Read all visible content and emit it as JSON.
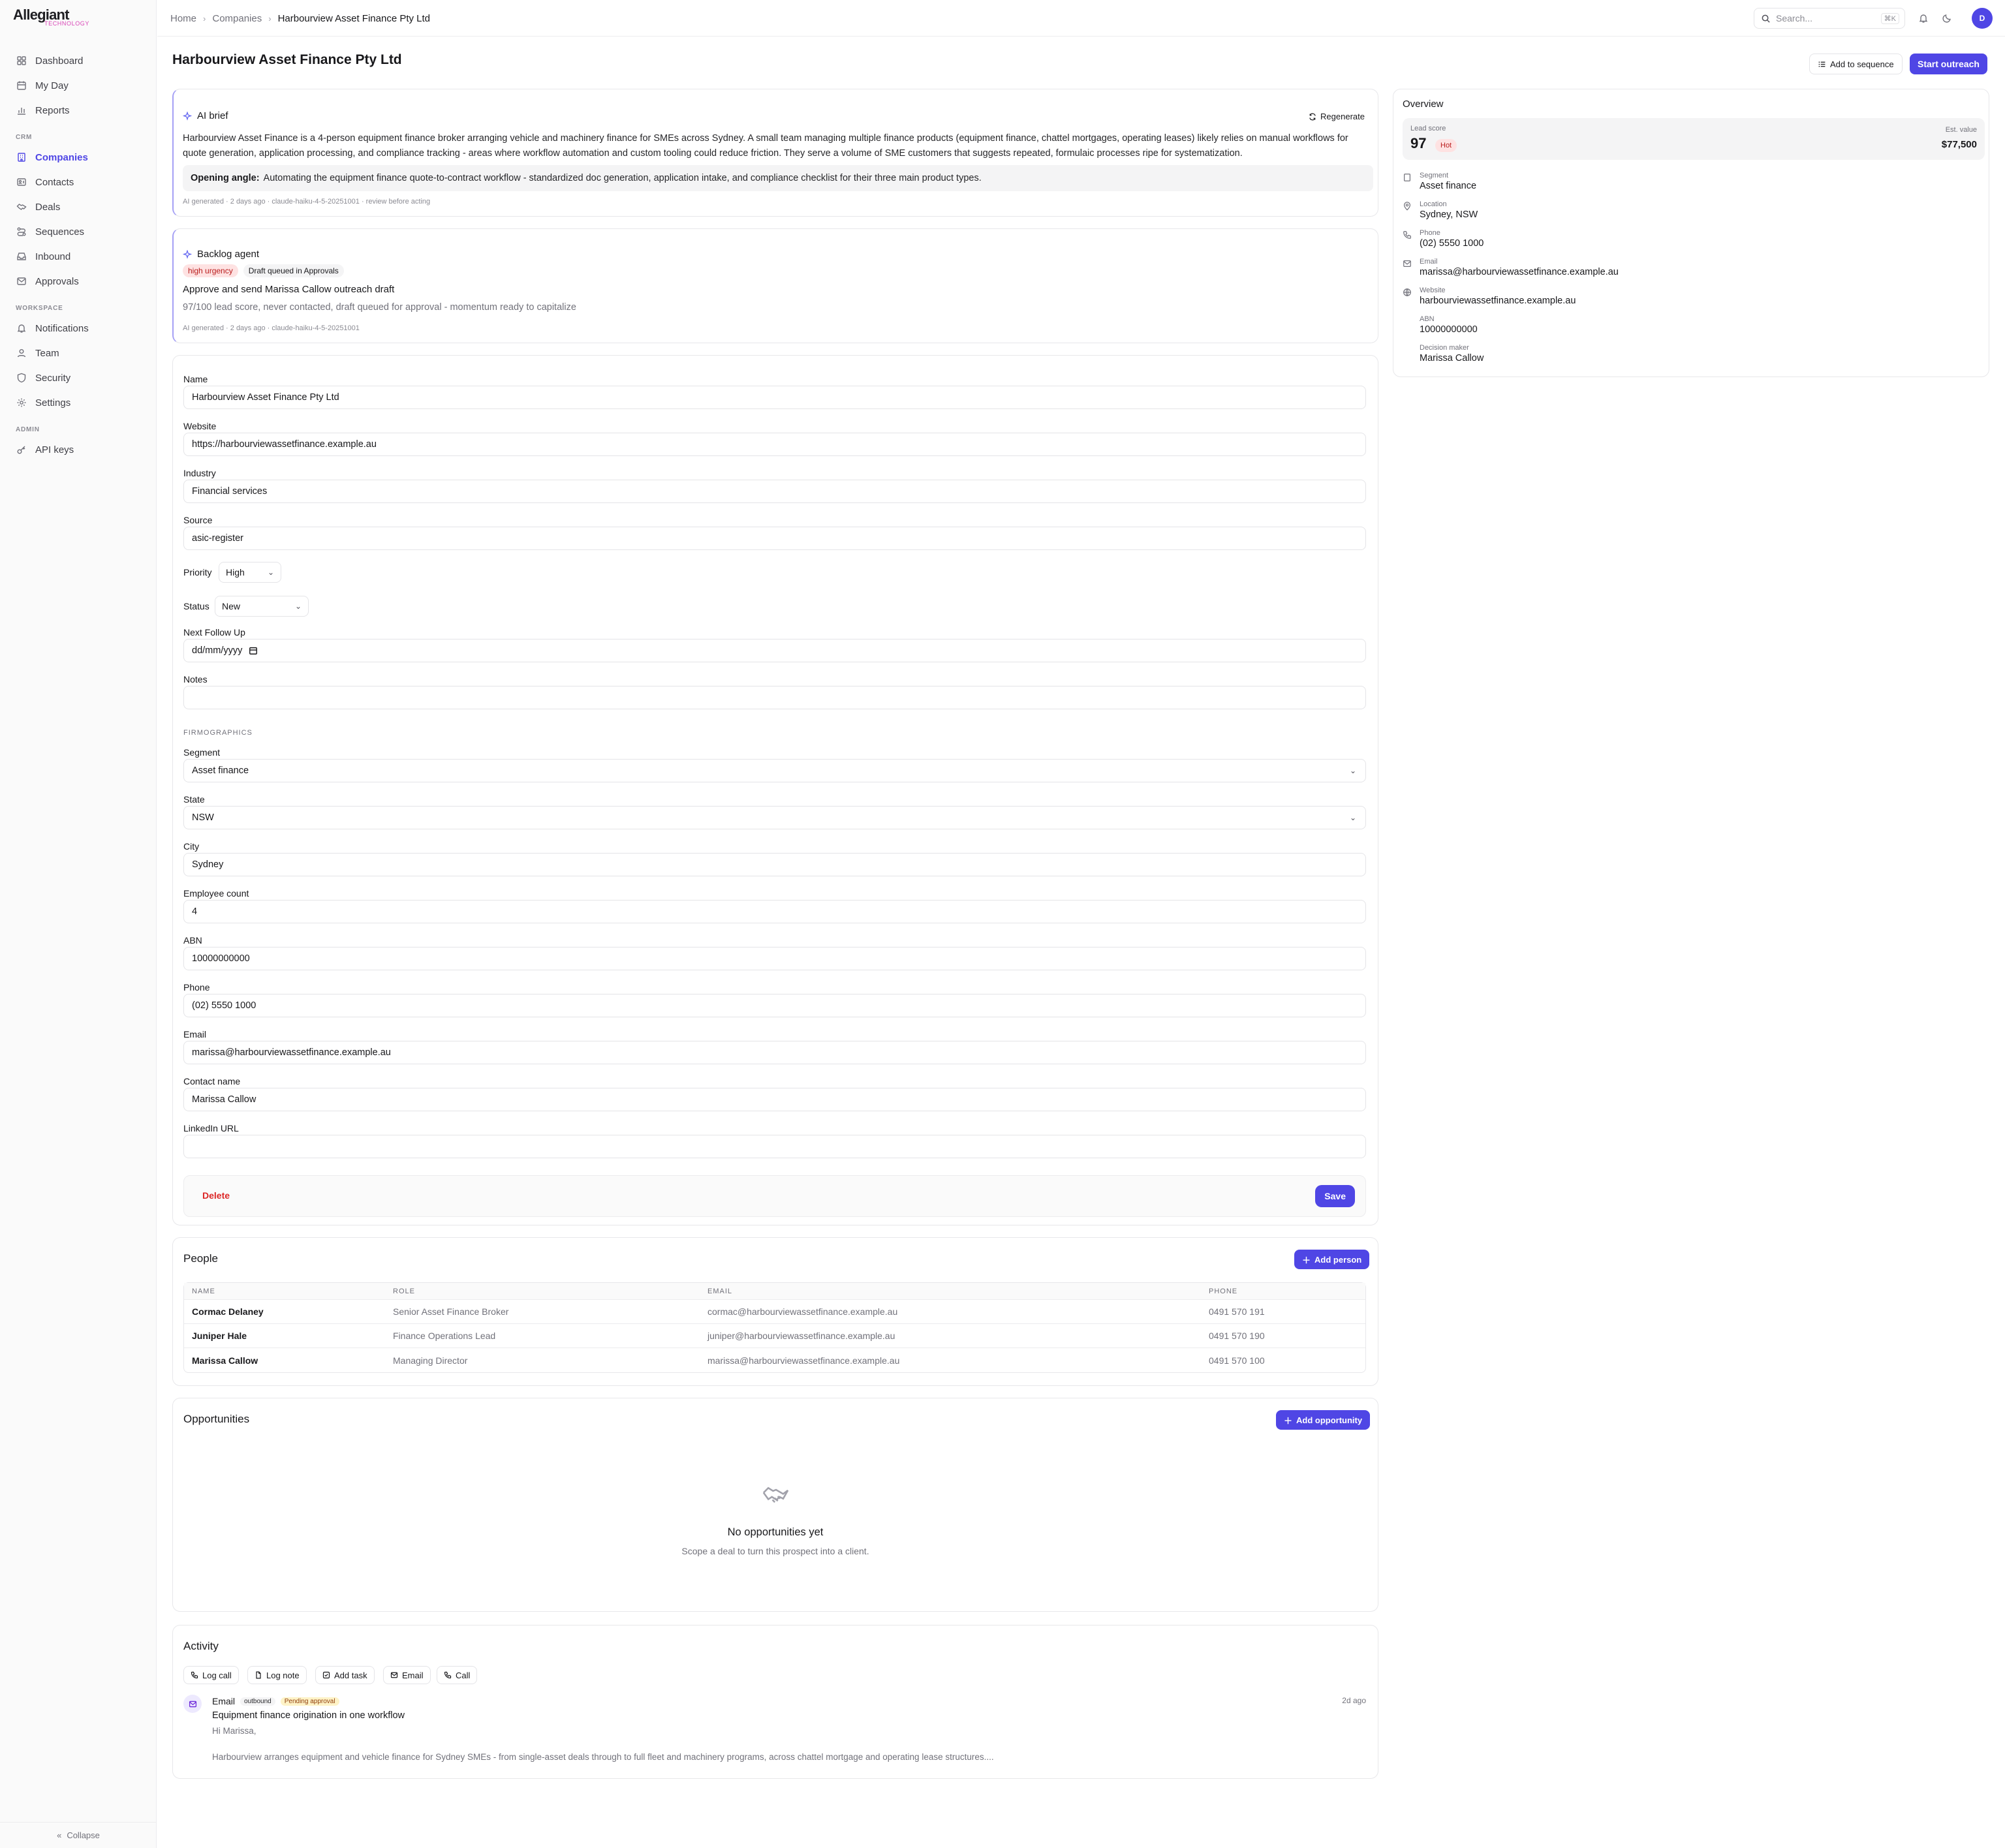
{
  "brand": {
    "name": "Allegiant",
    "sub": "TECHNOLOGY"
  },
  "sidebar": {
    "items": [
      {
        "label": "Dashboard"
      },
      {
        "label": "My Day"
      },
      {
        "label": "Reports"
      }
    ],
    "crm_label": "CRM",
    "crm_items": [
      {
        "label": "Companies"
      },
      {
        "label": "Contacts"
      },
      {
        "label": "Deals"
      },
      {
        "label": "Sequences"
      },
      {
        "label": "Inbound"
      },
      {
        "label": "Approvals"
      }
    ],
    "workspace_label": "WORKSPACE",
    "workspace_items": [
      {
        "label": "Notifications"
      },
      {
        "label": "Team"
      },
      {
        "label": "Security"
      },
      {
        "label": "Settings"
      }
    ],
    "admin_label": "ADMIN",
    "admin_items": [
      {
        "label": "API keys"
      }
    ],
    "collapse_label": "Collapse"
  },
  "header": {
    "breadcrumb": [
      "Home",
      "Companies",
      "Harbourview Asset Finance Pty Ltd"
    ],
    "search_placeholder": "Search...",
    "search_kbd": "⌘K",
    "avatar_initial": "D"
  },
  "page": {
    "title": "Harbourview Asset Finance Pty Ltd",
    "add_to_sequence": "Add to sequence",
    "start_outreach": "Start outreach"
  },
  "ai_brief": {
    "title": "AI brief",
    "regenerate": "Regenerate",
    "body": "Harbourview Asset Finance is a 4-person equipment finance broker arranging vehicle and machinery finance for SMEs across Sydney. A small team managing multiple finance products (equipment finance, chattel mortgages, operating leases) likely relies on manual workflows for quote generation, application processing, and compliance tracking - areas where workflow automation and custom tooling could reduce friction. They serve a volume of SME customers that suggests repeated, formulaic processes ripe for systematization.",
    "angle_label": "Opening angle:",
    "angle_text": "Automating the equipment finance quote-to-contract workflow - standardized doc generation, application intake, and compliance checklist for their three main product types.",
    "meta": "AI generated · 2 days ago · claude-haiku-4-5-20251001 · review before acting"
  },
  "backlog": {
    "title": "Backlog agent",
    "badge_urgency": "high urgency",
    "badge_status": "Draft queued in Approvals",
    "headline": "Approve and send Marissa Callow outreach draft",
    "detail": "97/100 lead score, never contacted, draft queued for approval - momentum ready to capitalize",
    "meta": "AI generated · 2 days ago · claude-haiku-4-5-20251001"
  },
  "form": {
    "name_label": "Name",
    "name_value": "Harbourview Asset Finance Pty Ltd",
    "website_label": "Website",
    "website_value": "https://harbourviewassetfinance.example.au",
    "industry_label": "Industry",
    "industry_value": "Financial services",
    "source_label": "Source",
    "source_value": "asic-register",
    "priority_label": "Priority",
    "priority_value": "High",
    "status_label": "Status",
    "status_value": "New",
    "followup_label": "Next Follow Up",
    "followup_value": "dd/mm/yyyy",
    "notes_label": "Notes",
    "notes_value": "",
    "firmographics_label": "FIRMOGRAPHICS",
    "segment_label": "Segment",
    "segment_value": "Asset finance",
    "state_label": "State",
    "state_value": "NSW",
    "city_label": "City",
    "city_value": "Sydney",
    "employees_label": "Employee count",
    "employees_value": "4",
    "abn_label": "ABN",
    "abn_value": "10000000000",
    "phone_label": "Phone",
    "phone_value": "(02) 5550 1000",
    "email_label": "Email",
    "email_value": "marissa@harbourviewassetfinance.example.au",
    "contact_label": "Contact name",
    "contact_value": "Marissa Callow",
    "linkedin_label": "LinkedIn URL",
    "linkedin_value": "",
    "delete": "Delete",
    "save": "Save"
  },
  "overview": {
    "title": "Overview",
    "lead_score_label": "Lead score",
    "lead_score": "97",
    "lead_badge": "Hot",
    "est_value_label": "Est. value",
    "est_value": "$77,500",
    "segment_label": "Segment",
    "segment": "Asset finance",
    "location_label": "Location",
    "location": "Sydney, NSW",
    "phone_label": "Phone",
    "phone": "(02) 5550 1000",
    "email_label": "Email",
    "email": "marissa@harbourviewassetfinance.example.au",
    "website_label": "Website",
    "website": "harbourviewassetfinance.example.au",
    "abn_label": "ABN",
    "abn": "10000000000",
    "decision_label": "Decision maker",
    "decision": "Marissa Callow"
  },
  "people": {
    "title": "People",
    "add": "Add person",
    "columns": [
      "NAME",
      "ROLE",
      "EMAIL",
      "PHONE"
    ],
    "rows": [
      {
        "name": "Cormac Delaney",
        "role": "Senior Asset Finance Broker",
        "email": "cormac@harbourviewassetfinance.example.au",
        "phone": "0491 570 191"
      },
      {
        "name": "Juniper Hale",
        "role": "Finance Operations Lead",
        "email": "juniper@harbourviewassetfinance.example.au",
        "phone": "0491 570 190"
      },
      {
        "name": "Marissa Callow",
        "role": "Managing Director",
        "email": "marissa@harbourviewassetfinance.example.au",
        "phone": "0491 570 100"
      }
    ]
  },
  "opportunities": {
    "title": "Opportunities",
    "add": "Add opportunity",
    "empty_title": "No opportunities yet",
    "empty_sub": "Scope a deal to turn this prospect into a client."
  },
  "activity": {
    "title": "Activity",
    "buttons": [
      "Log call",
      "Log note",
      "Add task",
      "Email",
      "Call"
    ],
    "item": {
      "type": "Email",
      "direction": "outbound",
      "status": "Pending approval",
      "time": "2d ago",
      "subject": "Equipment finance origination in one workflow",
      "greeting": "Hi Marissa,",
      "preview": "Harbourview arranges equipment and vehicle finance for Sydney SMEs - from single-asset deals through to full fleet and machinery programs, across chattel mortgage and operating lease structures...."
    }
  },
  "colors": {
    "accent": "#4f46e5",
    "hot": "#b91c1c",
    "pending": "#92400e"
  }
}
